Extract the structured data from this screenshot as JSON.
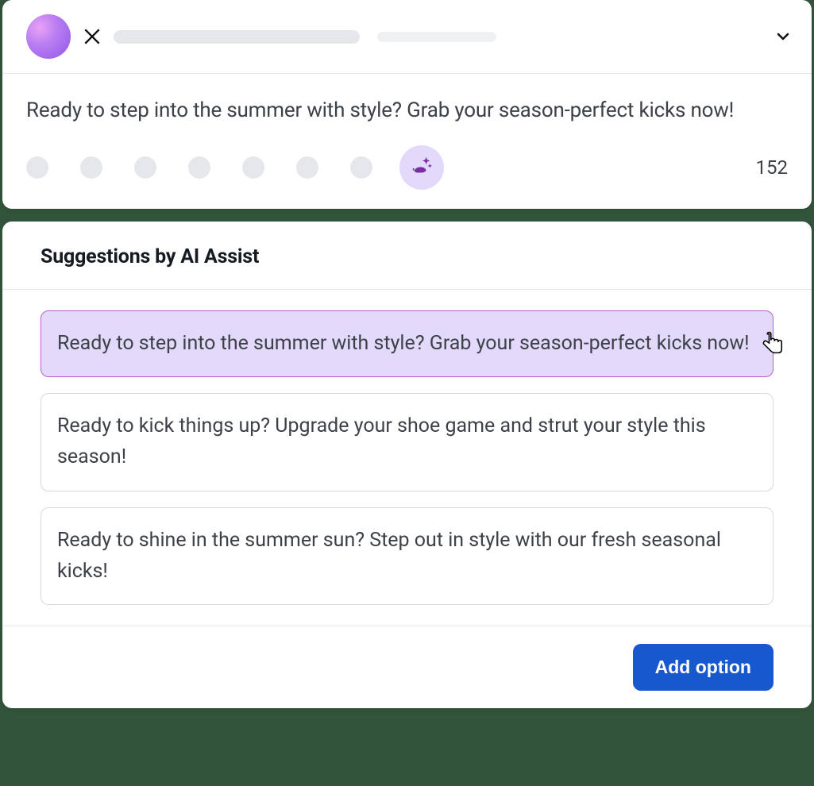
{
  "composer": {
    "post_text": "Ready to step into the summer with style? Grab your season-perfect kicks now!",
    "char_count": "152",
    "platform_icon": "x-icon"
  },
  "suggestions": {
    "title": "Suggestions by AI Assist",
    "items": [
      {
        "text": "Ready to step into the summer with style? Grab your season-perfect kicks now!",
        "selected": true
      },
      {
        "text": "Ready to kick things up? Upgrade your shoe game and strut your style this season!",
        "selected": false
      },
      {
        "text": "Ready to shine in the summer sun? Step out in style with our fresh seasonal kicks!",
        "selected": false
      }
    ]
  },
  "footer": {
    "add_option_label": "Add option"
  }
}
